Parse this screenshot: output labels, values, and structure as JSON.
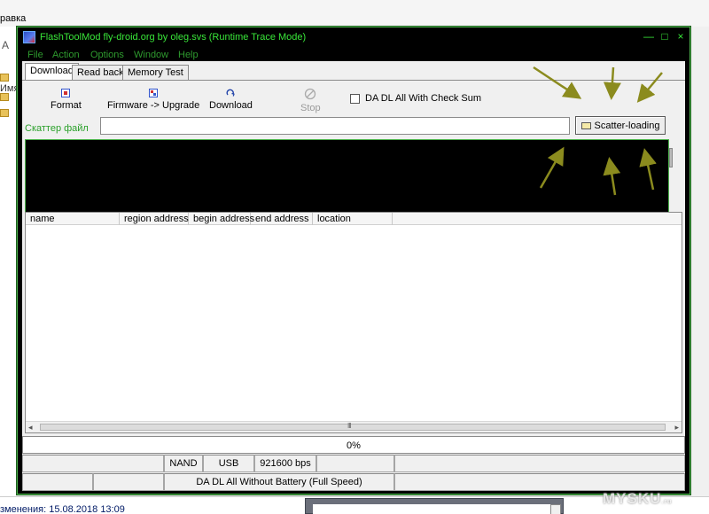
{
  "background_app": {
    "menu_text": "равка",
    "left_letter": "А",
    "left_label": "Имя",
    "status_text": "зменения: 15.08.2018 13:09"
  },
  "window": {
    "title": "FlashToolMod fly-droid.org by oleg.svs (Runtime Trace Mode)",
    "controls": {
      "minimize": "—",
      "maximize": "□",
      "close": "×"
    }
  },
  "menu": [
    {
      "label": "File"
    },
    {
      "label": "Action"
    },
    {
      "label": "Options"
    },
    {
      "label": "Window"
    },
    {
      "label": "Help"
    }
  ],
  "tabs": [
    {
      "label": "Download",
      "active": true
    },
    {
      "label": "Read back",
      "active": false
    },
    {
      "label": "Memory Test",
      "active": false
    }
  ],
  "toolbar": {
    "format": {
      "label": "Format",
      "icon": "format-icon"
    },
    "firmware_upgrade": {
      "label": "Firmware -> Upgrade",
      "icon": "upgrade-icon"
    },
    "download": {
      "label": "Download",
      "icon": "download-arrow-icon"
    },
    "stop": {
      "label": "Stop",
      "icon": "stop-icon",
      "disabled": true
    },
    "checksum_label": "DA DL All With Check Sum"
  },
  "scatter": {
    "label": "Скаттер файл",
    "value": "",
    "button_label": "Scatter-loading"
  },
  "table": {
    "columns": [
      "name",
      "region address",
      "begin address",
      "end address",
      "location"
    ],
    "rows": []
  },
  "scrollbar": {
    "grip": "III"
  },
  "progress": {
    "value": 0,
    "text": "0%"
  },
  "status": {
    "flash_type": "NAND",
    "connection": "USB",
    "baud_rate": "921600 bps",
    "mode": "DA DL All Without Battery (Full Speed)"
  },
  "colors": {
    "accent_green": "#39e639",
    "annotation_arrow": "#8b8b1e",
    "progress_fill": "#3a8ee6"
  },
  "watermark": {
    "text": "MYSKU",
    "suffix": ".ru"
  }
}
